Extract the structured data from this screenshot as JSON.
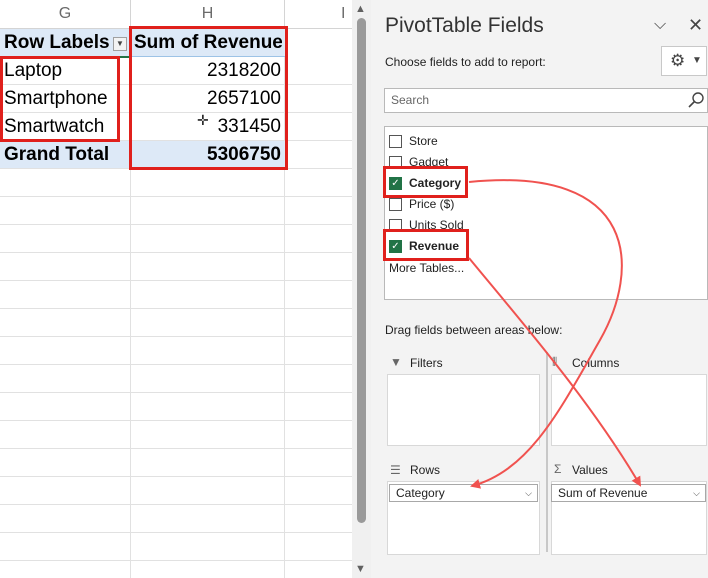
{
  "sheet": {
    "columns": [
      "G",
      "H",
      "I"
    ],
    "header": {
      "row_labels": "Row Labels",
      "sum_header": "Sum of Revenue"
    },
    "rows": [
      {
        "label": "Laptop",
        "value": "2318200"
      },
      {
        "label": "Smartphone",
        "value": "2657100"
      },
      {
        "label": "Smartwatch",
        "value": "331450"
      }
    ],
    "total": {
      "label": "Grand Total",
      "value": "5306750"
    }
  },
  "pane": {
    "title": "PivotTable Fields",
    "choose_text": "Choose fields to add to report:",
    "search_placeholder": "Search",
    "fields": [
      {
        "label": "Store",
        "checked": false
      },
      {
        "label": "Gadget",
        "checked": false
      },
      {
        "label": "Category",
        "checked": true
      },
      {
        "label": "Price ($)",
        "checked": false
      },
      {
        "label": "Units Sold",
        "checked": false
      },
      {
        "label": "Revenue",
        "checked": true
      }
    ],
    "more_tables": "More Tables...",
    "drag_text": "Drag fields between areas below:",
    "areas": {
      "filters": "Filters",
      "columns": "Columns",
      "rows": "Rows",
      "values": "Values",
      "rows_chip": "Category",
      "values_chip": "Sum of Revenue"
    }
  },
  "colors": {
    "highlight_red": "#e0201c",
    "checkbox_green": "#217346",
    "pivot_header_fill": "#dde9f7"
  }
}
